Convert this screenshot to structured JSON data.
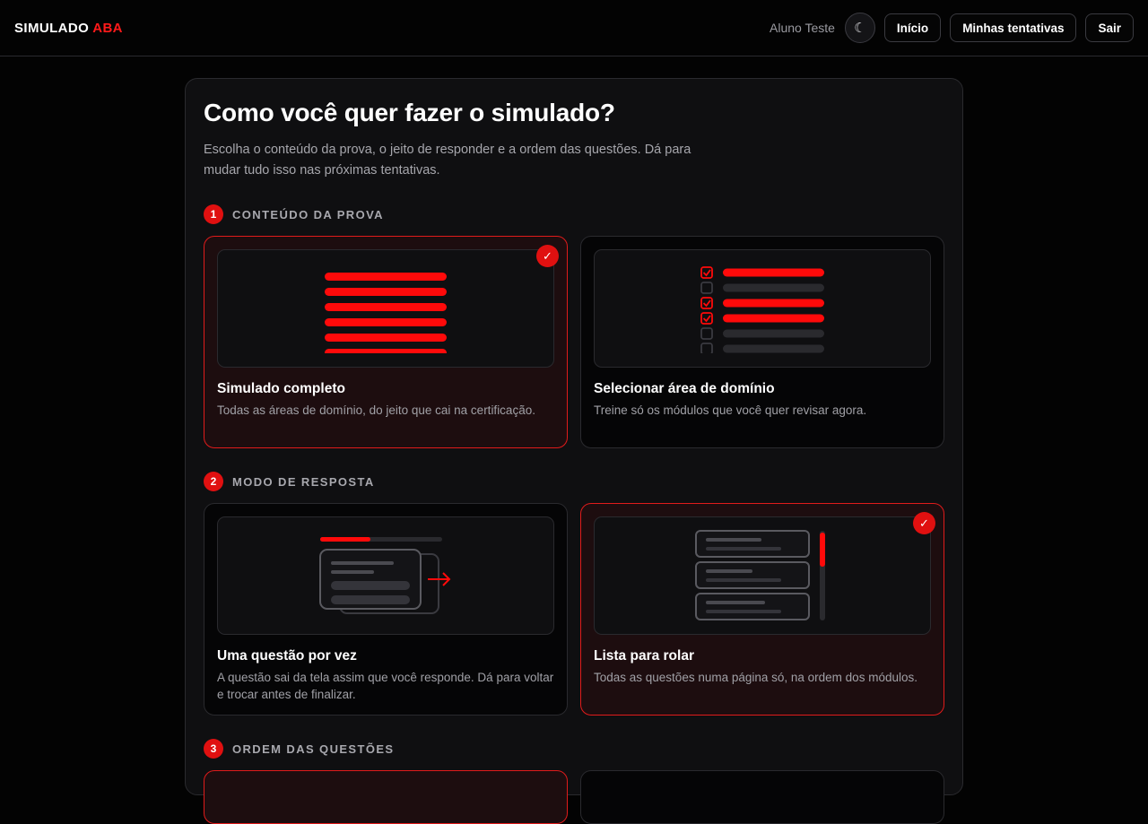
{
  "brand": {
    "name": "SIMULADO",
    "accent": "ABA"
  },
  "header": {
    "user": "Aluno Teste",
    "theme_icon": "moon-icon",
    "theme_glyph": "☾",
    "nav": [
      "Início",
      "Minhas tentativas",
      "Sair"
    ]
  },
  "page": {
    "title": "Como você quer fazer o simulado?",
    "subtitle": "Escolha o conteúdo da prova, o jeito de responder e a ordem das questões. Dá para mudar tudo isso nas próximas tentativas."
  },
  "sections": [
    {
      "number": "1",
      "label": "CONTEÚDO DA PROVA",
      "cards": [
        {
          "title": "Simulado completo",
          "description": "Todas as áreas de domínio, do jeito que cai na certificação.",
          "selected": true,
          "icon": "full-exam-illustration"
        },
        {
          "title": "Selecionar área de domínio",
          "description": "Treine só os módulos que você quer revisar agora.",
          "selected": false,
          "icon": "select-domain-illustration"
        }
      ]
    },
    {
      "number": "2",
      "label": "MODO DE RESPOSTA",
      "cards": [
        {
          "title": "Uma questão por vez",
          "description": "A questão sai da tela assim que você responde. Dá para voltar e trocar antes de finalizar.",
          "selected": false,
          "icon": "one-at-a-time-illustration"
        },
        {
          "title": "Lista para rolar",
          "description": "Todas as questões numa página só, na ordem dos módulos.",
          "selected": true,
          "icon": "scroll-list-illustration"
        }
      ]
    },
    {
      "number": "3",
      "label": "ORDEM DAS QUESTÕES"
    }
  ],
  "check_glyph": "✓",
  "colors": {
    "accent": "#e01010",
    "selected_bg": "#1d0d0f",
    "panel_bg": "#0f0f11",
    "border": "#2a2a2e"
  }
}
